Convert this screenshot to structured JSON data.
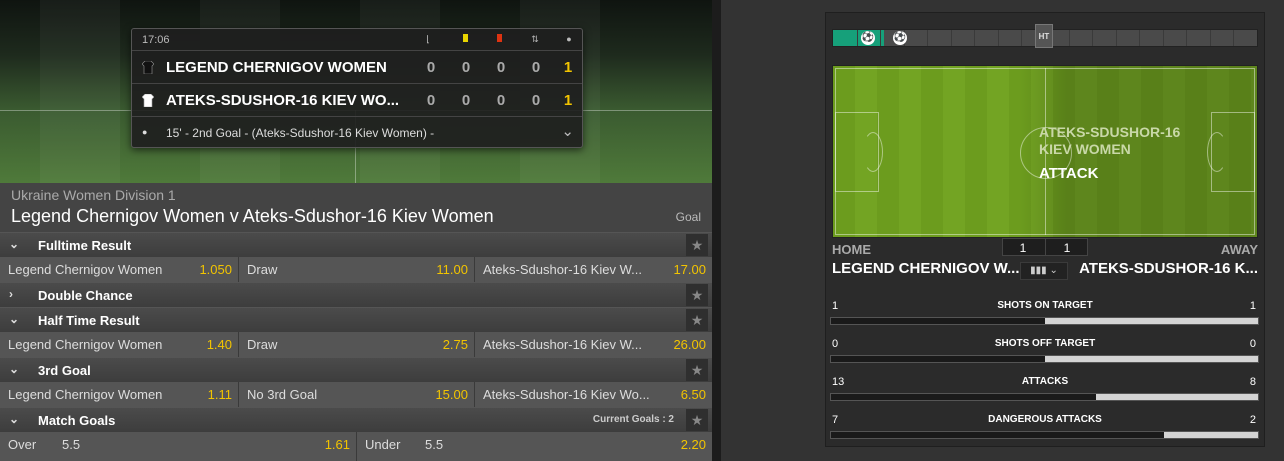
{
  "scoreboard": {
    "time": "17:06",
    "header_icons": [
      "corner-icon",
      "yellow-card-icon",
      "red-card-icon",
      "substitution-icon",
      "goal-icon"
    ],
    "home": {
      "name": "LEGEND CHERNIGOV WOMEN",
      "stats": [
        "0",
        "0",
        "0",
        "0",
        "1"
      ]
    },
    "away": {
      "name": "ATEKS-SDUSHOR-16 KIEV WO...",
      "stats": [
        "0",
        "0",
        "0",
        "0",
        "1"
      ]
    },
    "last_event": "15' - 2nd Goal -   (Ateks-Sdushor-16 Kiev Women) -",
    "colors": {
      "gold": "#f2c400"
    }
  },
  "event": {
    "league": "Ukraine Women Division 1",
    "title": "Legend Chernigov Women v Ateks-Sdushor-16 Kiev Women",
    "status": "Goal"
  },
  "markets": [
    {
      "name": "Fulltime Result",
      "expanded": true,
      "selections": [
        {
          "name": "Legend Chernigov Women",
          "odds": "1.050"
        },
        {
          "name": "Draw",
          "odds": "11.00"
        },
        {
          "name": "Ateks-Sdushor-16 Kiev W...",
          "odds": "17.00"
        }
      ]
    },
    {
      "name": "Double Chance",
      "expanded": false,
      "selections": []
    },
    {
      "name": "Half Time Result",
      "expanded": true,
      "selections": [
        {
          "name": "Legend Chernigov Women",
          "odds": "1.40"
        },
        {
          "name": "Draw",
          "odds": "2.75"
        },
        {
          "name": "Ateks-Sdushor-16 Kiev W...",
          "odds": "26.00"
        }
      ]
    },
    {
      "name": "3rd Goal",
      "expanded": true,
      "selections": [
        {
          "name": "Legend Chernigov Women",
          "odds": "1.11"
        },
        {
          "name": "No 3rd Goal",
          "odds": "15.00"
        },
        {
          "name": "Ateks-Sdushor-16 Kiev Wo...",
          "odds": "6.50"
        }
      ]
    },
    {
      "name": "Match Goals",
      "expanded": true,
      "extra": "Current Goals : 2",
      "selections": [
        {
          "name": "Over",
          "line": "5.5",
          "odds": "1.61"
        },
        {
          "name": "Under",
          "line": "5.5",
          "odds": "2.20"
        }
      ]
    }
  ],
  "tracker": {
    "timeline_label": "HT",
    "timeline_progress": 0.12,
    "attack_team": "ATEKS-SDUSHOR-16\nKIEV WOMEN",
    "attack_label": "ATTACK",
    "home_label": "HOME",
    "away_label": "AWAY",
    "home_name": "LEGEND CHERNIGOV W...",
    "away_name": "ATEKS-SDUSHOR-16 K...",
    "home_score": "1",
    "away_score": "1",
    "stats": [
      {
        "label": "SHOTS ON TARGET",
        "home": "1",
        "away": "1",
        "home_share": 0.5
      },
      {
        "label": "SHOTS OFF TARGET",
        "home": "0",
        "away": "0",
        "home_share": 0.5
      },
      {
        "label": "ATTACKS",
        "home": "13",
        "away": "8",
        "home_share": 0.62
      },
      {
        "label": "DANGEROUS ATTACKS",
        "home": "7",
        "away": "2",
        "home_share": 0.78
      }
    ]
  }
}
